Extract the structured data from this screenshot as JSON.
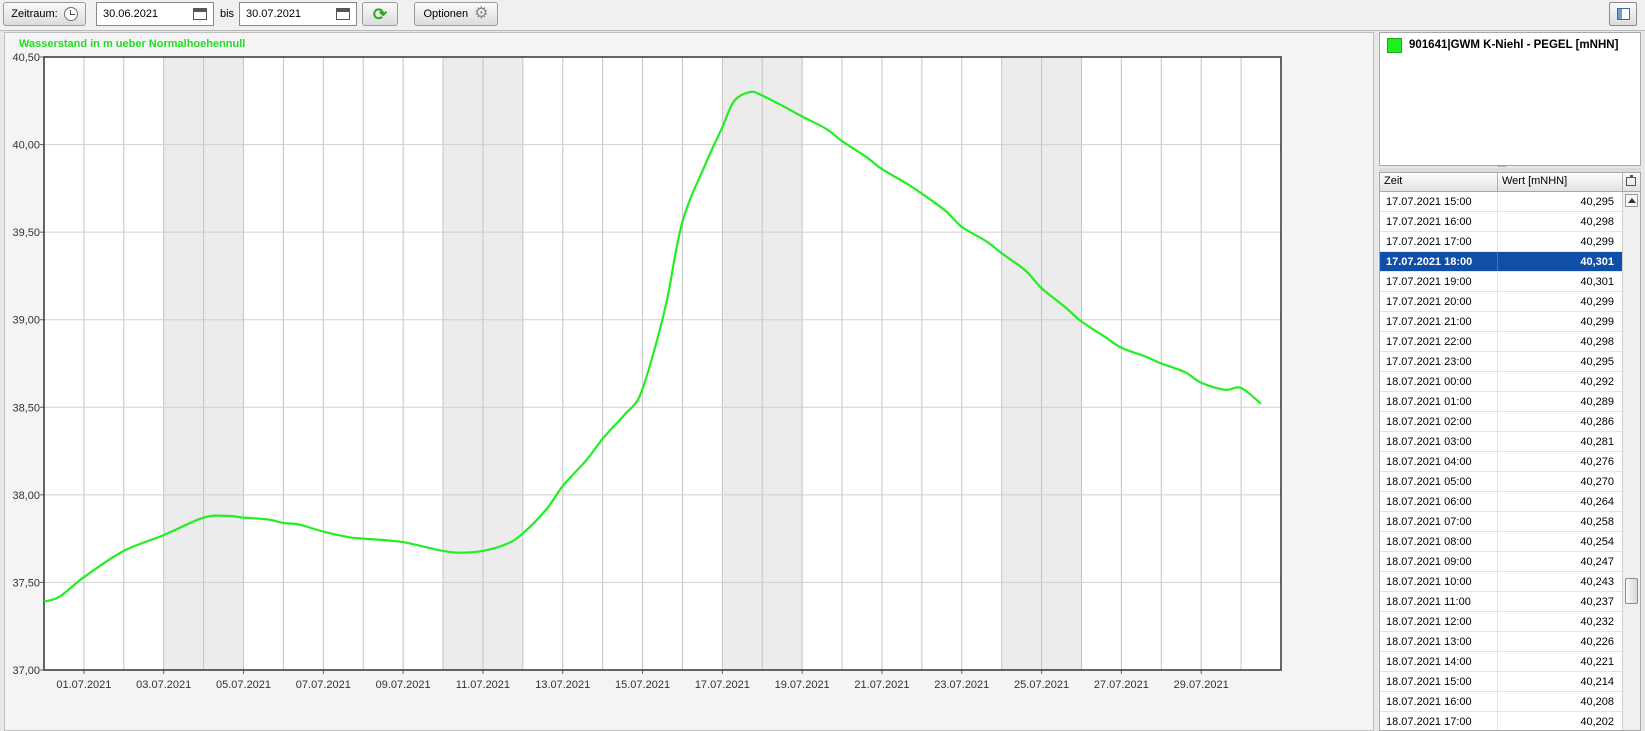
{
  "toolbar": {
    "zeitraum_label": "Zeitraum:",
    "date_from": "30.06.2021",
    "bis_label": "bis",
    "date_to": "30.07.2021",
    "optionen_label": "Optionen",
    "refresh_icon": "refresh-icon",
    "gear_icon": "gear-icon",
    "clock_icon": "clock-icon",
    "calendar_icon": "calendar-icon"
  },
  "legend": {
    "label": "901641|GWM K-Niehl - PEGEL [mNHN]",
    "color": "#1ef01e"
  },
  "table": {
    "col_zeit": "Zeit",
    "col_wert": "Wert [mNHN]",
    "selected_index": 3,
    "selected_color": "#0f4fa8",
    "rows": [
      {
        "zeit": "17.07.2021 15:00",
        "wert": "40,295"
      },
      {
        "zeit": "17.07.2021 16:00",
        "wert": "40,298"
      },
      {
        "zeit": "17.07.2021 17:00",
        "wert": "40,299"
      },
      {
        "zeit": "17.07.2021 18:00",
        "wert": "40,301"
      },
      {
        "zeit": "17.07.2021 19:00",
        "wert": "40,301"
      },
      {
        "zeit": "17.07.2021 20:00",
        "wert": "40,299"
      },
      {
        "zeit": "17.07.2021 21:00",
        "wert": "40,299"
      },
      {
        "zeit": "17.07.2021 22:00",
        "wert": "40,298"
      },
      {
        "zeit": "17.07.2021 23:00",
        "wert": "40,295"
      },
      {
        "zeit": "18.07.2021 00:00",
        "wert": "40,292"
      },
      {
        "zeit": "18.07.2021 01:00",
        "wert": "40,289"
      },
      {
        "zeit": "18.07.2021 02:00",
        "wert": "40,286"
      },
      {
        "zeit": "18.07.2021 03:00",
        "wert": "40,281"
      },
      {
        "zeit": "18.07.2021 04:00",
        "wert": "40,276"
      },
      {
        "zeit": "18.07.2021 05:00",
        "wert": "40,270"
      },
      {
        "zeit": "18.07.2021 06:00",
        "wert": "40,264"
      },
      {
        "zeit": "18.07.2021 07:00",
        "wert": "40,258"
      },
      {
        "zeit": "18.07.2021 08:00",
        "wert": "40,254"
      },
      {
        "zeit": "18.07.2021 09:00",
        "wert": "40,247"
      },
      {
        "zeit": "18.07.2021 10:00",
        "wert": "40,243"
      },
      {
        "zeit": "18.07.2021 11:00",
        "wert": "40,237"
      },
      {
        "zeit": "18.07.2021 12:00",
        "wert": "40,232"
      },
      {
        "zeit": "18.07.2021 13:00",
        "wert": "40,226"
      },
      {
        "zeit": "18.07.2021 14:00",
        "wert": "40,221"
      },
      {
        "zeit": "18.07.2021 15:00",
        "wert": "40,214"
      },
      {
        "zeit": "18.07.2021 16:00",
        "wert": "40,208"
      },
      {
        "zeit": "18.07.2021 17:00",
        "wert": "40,202"
      }
    ]
  },
  "chart_data": {
    "type": "line",
    "title": "Wasserstand in m ueber Normalhoehennull",
    "xlabel": "",
    "ylabel": "",
    "line_color": "#22ee22",
    "weekend_shade_color": "#ececec",
    "grid": true,
    "xlim_days": [
      0,
      31
    ],
    "ylim": [
      37.0,
      40.5
    ],
    "y_ticks": [
      37.0,
      37.5,
      38.0,
      38.5,
      39.0,
      39.5,
      40.0,
      40.5
    ],
    "y_tick_labels": [
      "37,00",
      "37,50",
      "38,00",
      "38,50",
      "39,00",
      "39,50",
      "40,00",
      "40,50"
    ],
    "x_ticks": [
      {
        "day": 1,
        "label": "01.07.2021"
      },
      {
        "day": 3,
        "label": "03.07.2021"
      },
      {
        "day": 5,
        "label": "05.07.2021"
      },
      {
        "day": 7,
        "label": "07.07.2021"
      },
      {
        "day": 9,
        "label": "09.07.2021"
      },
      {
        "day": 11,
        "label": "11.07.2021"
      },
      {
        "day": 13,
        "label": "13.07.2021"
      },
      {
        "day": 15,
        "label": "15.07.2021"
      },
      {
        "day": 17,
        "label": "17.07.2021"
      },
      {
        "day": 19,
        "label": "19.07.2021"
      },
      {
        "day": 21,
        "label": "21.07.2021"
      },
      {
        "day": 23,
        "label": "23.07.2021"
      },
      {
        "day": 25,
        "label": "25.07.2021"
      },
      {
        "day": 27,
        "label": "27.07.2021"
      },
      {
        "day": 29,
        "label": "29.07.2021"
      }
    ],
    "weekend_bands": [
      [
        3,
        5
      ],
      [
        10,
        12
      ],
      [
        17,
        19
      ],
      [
        24,
        26
      ]
    ],
    "series": [
      {
        "name": "901641|GWM K-Niehl - PEGEL [mNHN]",
        "x": [
          0,
          0.4,
          1.0,
          2.0,
          3.0,
          4.0,
          4.6,
          5.0,
          5.6,
          6.0,
          6.4,
          7.0,
          7.6,
          8.0,
          8.6,
          9.0,
          9.6,
          10.0,
          10.4,
          11.0,
          11.6,
          12.0,
          12.6,
          13.0,
          13.6,
          14.0,
          14.4,
          14.6,
          14.9,
          15.2,
          15.6,
          16.0,
          16.6,
          17.0,
          17.3,
          17.7,
          18.0,
          18.6,
          19.0,
          19.6,
          20.0,
          20.6,
          21.0,
          21.6,
          22.0,
          22.6,
          23.0,
          23.6,
          24.0,
          24.6,
          25.0,
          25.6,
          26.0,
          26.6,
          27.0,
          27.6,
          28.0,
          28.6,
          29.0,
          29.6,
          30.0,
          30.5
        ],
        "y": [
          37.39,
          37.42,
          37.53,
          37.68,
          37.77,
          37.87,
          37.88,
          37.87,
          37.86,
          37.84,
          37.83,
          37.79,
          37.76,
          37.75,
          37.74,
          37.73,
          37.7,
          37.68,
          37.67,
          37.68,
          37.72,
          37.78,
          37.92,
          38.05,
          38.2,
          38.32,
          38.42,
          38.47,
          38.55,
          38.75,
          39.1,
          39.56,
          39.9,
          40.1,
          40.25,
          40.3,
          40.28,
          40.21,
          40.16,
          40.09,
          40.02,
          39.93,
          39.86,
          39.78,
          39.72,
          39.62,
          39.53,
          39.45,
          39.38,
          39.28,
          39.18,
          39.07,
          38.99,
          38.9,
          38.84,
          38.79,
          38.75,
          38.7,
          38.64,
          38.6,
          38.61,
          38.52
        ]
      }
    ]
  }
}
